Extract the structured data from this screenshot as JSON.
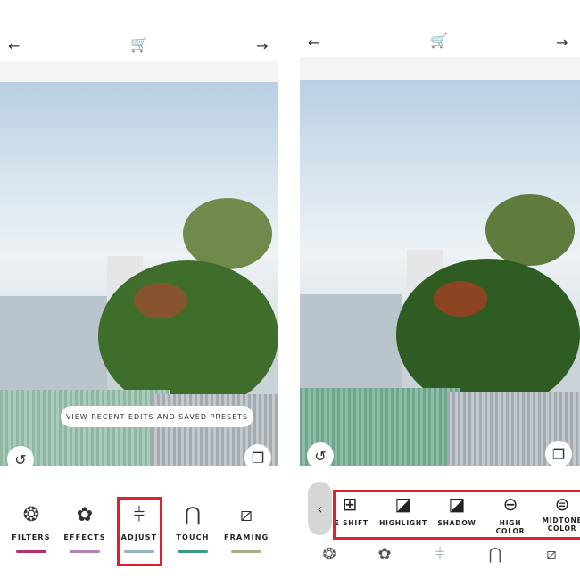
{
  "left_screen": {
    "top_bar": {
      "back_icon": "arrow-left",
      "cart_icon": "cart",
      "forward_icon": "arrow-right"
    },
    "tooltip": "VIEW RECENT EDITS AND SAVED PRESETS",
    "undo_icon": "undo",
    "layers_icon": "layers",
    "toolbar": [
      {
        "label": "FILTERS",
        "icon": "filters",
        "color": "#b2316e"
      },
      {
        "label": "EFFECTS",
        "icon": "effects",
        "color": "#b383b5"
      },
      {
        "label": "ADJUST",
        "icon": "sliders",
        "color": "#94b3c0",
        "highlighted": true
      },
      {
        "label": "TOUCH",
        "icon": "touch",
        "color": "#3d9a87"
      },
      {
        "label": "FRAMING",
        "icon": "crop",
        "color": "#a3b085"
      }
    ]
  },
  "right_screen": {
    "top_bar": {
      "back_icon": "arrow-left",
      "cart_icon": "cart",
      "forward_icon": "arrow-right"
    },
    "undo_icon": "undo",
    "layers_icon": "layers",
    "back_button": "‹",
    "adjust_tools": [
      {
        "label": "IE SHIFT",
        "icon": "tone-shift"
      },
      {
        "label": "HIGHLIGHT",
        "icon": "highlight"
      },
      {
        "label": "SHADOW",
        "icon": "shadow"
      },
      {
        "label": "HIGH COLOR",
        "icon": "high-color"
      },
      {
        "label": "MIDTONE COLOR",
        "icon": "midtone-color"
      }
    ],
    "bottom_nav": [
      "filters",
      "effects",
      "sliders",
      "touch",
      "crop"
    ]
  }
}
